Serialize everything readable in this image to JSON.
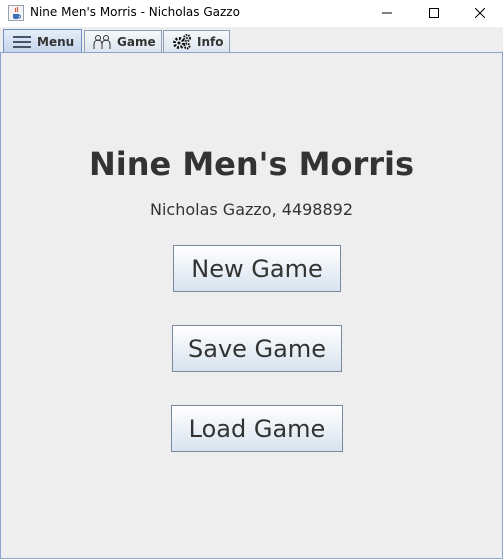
{
  "window": {
    "title": "Nine Men's Morris - Nicholas Gazzo",
    "icon": "java-cup-icon",
    "controls": [
      "minimize-icon",
      "maximize-icon",
      "close-icon"
    ]
  },
  "tabs": [
    {
      "label": "Menu",
      "icon": "hamburger-menu-icon",
      "active": true
    },
    {
      "label": "Game",
      "icon": "people-icon",
      "active": false
    },
    {
      "label": "Info",
      "icon": "gears-icon",
      "active": false
    }
  ],
  "menu": {
    "title": "Nine Men's Morris",
    "author": "Nicholas Gazzo, 4498892",
    "buttons": {
      "new_game": "New Game",
      "save_game": "Save Game",
      "load_game": "Load Game"
    }
  }
}
